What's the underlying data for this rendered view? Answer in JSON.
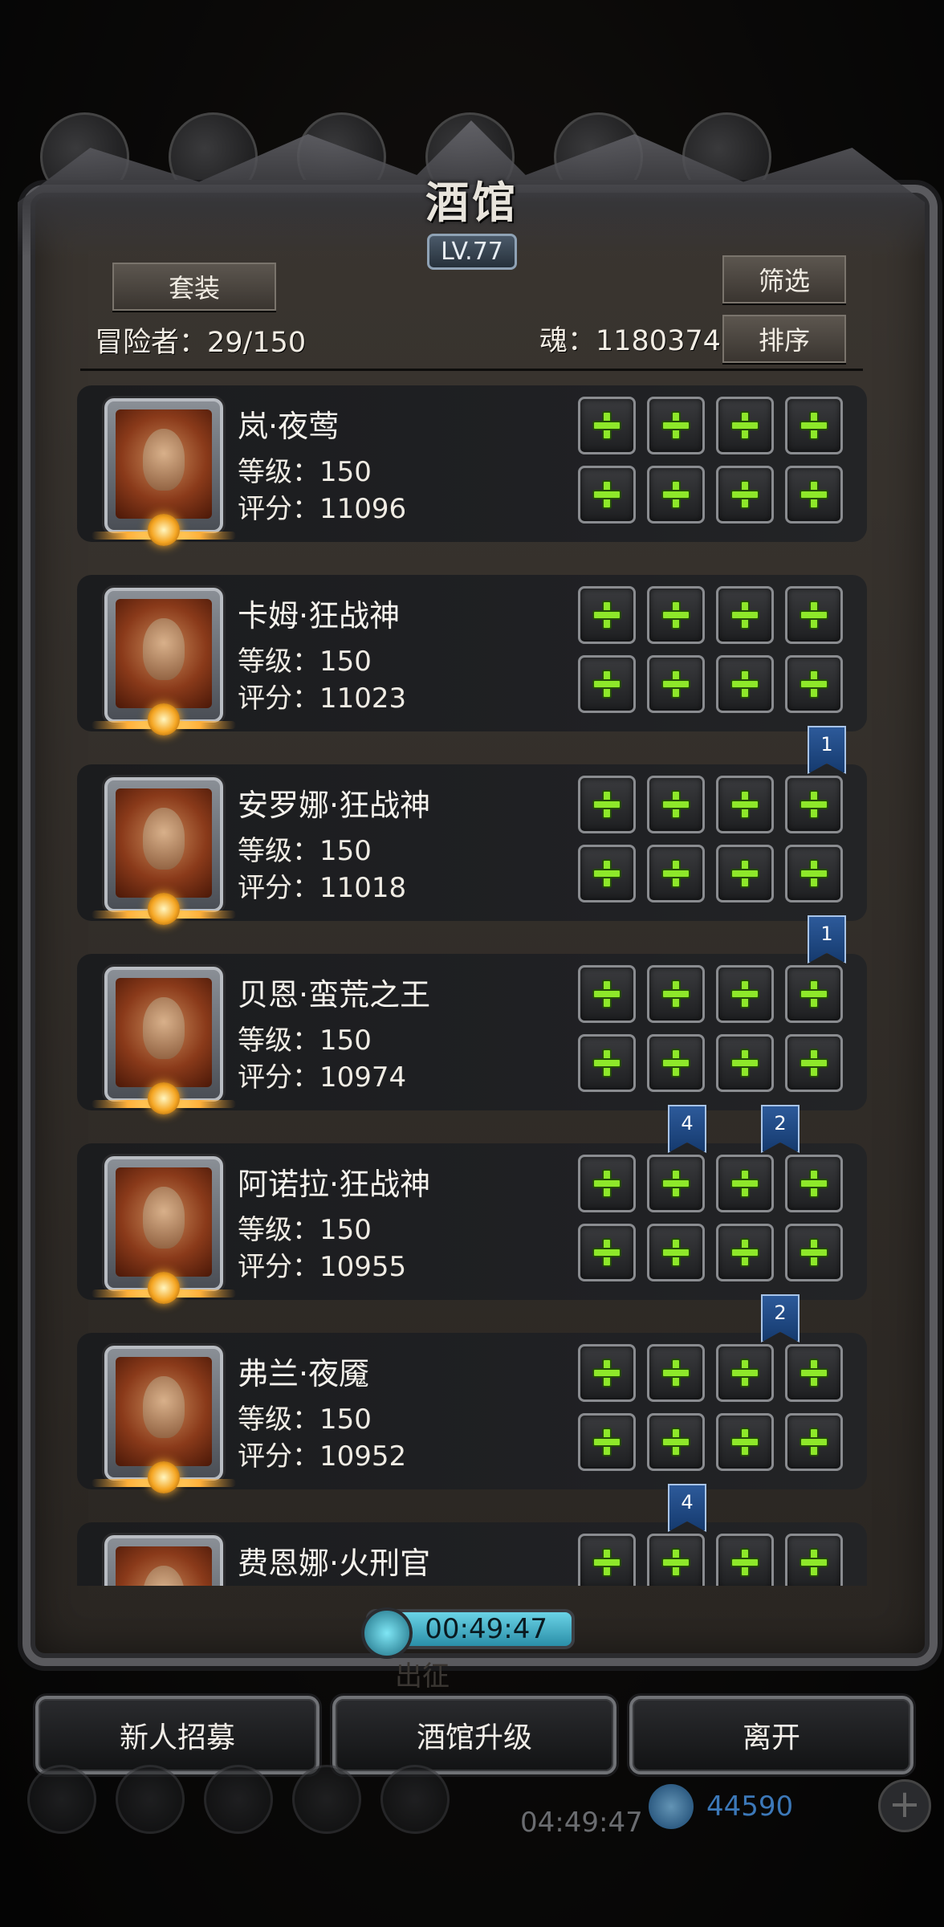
{
  "title": "酒馆",
  "level": "LV.77",
  "buttons": {
    "set": "套装",
    "filter": "筛选",
    "sort": "排序"
  },
  "adventurers": "冒险者：29/150",
  "soul": "魂：1180374",
  "heroes": [
    {
      "name": "岚·夜莺",
      "level": "等级：150",
      "score": "评分：11096"
    },
    {
      "name": "卡姆·狂战神",
      "level": "等级：150",
      "score": "评分：11023"
    },
    {
      "name": "安罗娜·狂战神",
      "level": "等级：150",
      "score": "评分：11018"
    },
    {
      "name": "贝恩·蛮荒之王",
      "level": "等级：150",
      "score": "评分：10974"
    },
    {
      "name": "阿诺拉·狂战神",
      "level": "等级：150",
      "score": "评分：10955"
    },
    {
      "name": "弗兰·夜魇",
      "level": "等级：150",
      "score": "评分：10952"
    },
    {
      "name": "费恩娜·火刑官",
      "level": "",
      "score": ""
    }
  ],
  "ribbons": [
    "1",
    "1",
    "4",
    "2",
    "2",
    "4"
  ],
  "timer": "00:49:47",
  "ghost_label": "出征",
  "bottom": {
    "recruit": "新人招募",
    "upgrade": "酒馆升级",
    "leave": "离开"
  },
  "hud": {
    "clock": "04:49:47",
    "gems": "44590",
    "plus": "+"
  }
}
